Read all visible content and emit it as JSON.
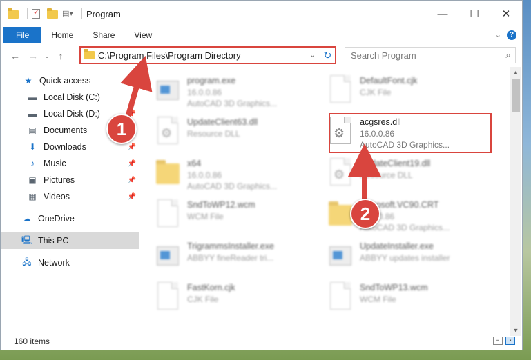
{
  "window": {
    "title": "Program"
  },
  "controls": {
    "minimize": "—",
    "maximize": "☐",
    "close": "✕"
  },
  "ribbon": {
    "tabs": [
      "File",
      "Home",
      "Share",
      "View"
    ]
  },
  "address": {
    "path": "C:\\Program Files\\Program Directory"
  },
  "search": {
    "placeholder": "Search Program"
  },
  "sidebar": {
    "items": [
      {
        "label": "Quick access",
        "icon": "star-icon",
        "pinned": false
      },
      {
        "label": "Local Disk (C:)",
        "icon": "drive-icon",
        "pinned": false
      },
      {
        "label": "Local Disk (D:)",
        "icon": "drive-icon",
        "pinned": true
      },
      {
        "label": "Documents",
        "icon": "documents-icon",
        "pinned": true
      },
      {
        "label": "Downloads",
        "icon": "download-icon",
        "pinned": true
      },
      {
        "label": "Music",
        "icon": "music-icon",
        "pinned": true
      },
      {
        "label": "Pictures",
        "icon": "pictures-icon",
        "pinned": true
      },
      {
        "label": "Videos",
        "icon": "videos-icon",
        "pinned": true
      },
      {
        "label": "OneDrive",
        "icon": "cloud-icon",
        "pinned": false
      },
      {
        "label": "This PC",
        "icon": "computer-icon",
        "pinned": false,
        "selected": true
      },
      {
        "label": "Network",
        "icon": "network-icon",
        "pinned": false
      }
    ]
  },
  "files": [
    {
      "name": "program.exe",
      "meta1": "16.0.0.86",
      "meta2": "AutoCAD 3D Graphics...",
      "kind": "exe"
    },
    {
      "name": "DefaultFont.cjk",
      "meta1": "CJK File",
      "meta2": "",
      "kind": "doc"
    },
    {
      "name": "UpdateClient63.dll",
      "meta1": "Resource DLL",
      "meta2": "",
      "kind": "dll"
    },
    {
      "name": "acgsres.dll",
      "meta1": "16.0.0.86",
      "meta2": "AutoCAD 3D Graphics...",
      "kind": "dll",
      "highlight": true
    },
    {
      "name": "x64",
      "meta1": "16.0.0.86",
      "meta2": "AutoCAD 3D Graphics...",
      "kind": "folder"
    },
    {
      "name": "UpdateClient19.dll",
      "meta1": "Resource DLL",
      "meta2": "",
      "kind": "dll"
    },
    {
      "name": "SndToWP12.wcm",
      "meta1": "WCM File",
      "meta2": "",
      "kind": "doc"
    },
    {
      "name": "Microsoft.VC90.CRT",
      "meta1": "16.0.0.86",
      "meta2": "AutoCAD 3D Graphics...",
      "kind": "folder"
    },
    {
      "name": "TrigrammsInstaller.exe",
      "meta1": "ABBYY fineReader tri...",
      "meta2": "",
      "kind": "exe"
    },
    {
      "name": "UpdateInstaller.exe",
      "meta1": "ABBYY updates installer",
      "meta2": "",
      "kind": "exe"
    },
    {
      "name": "FastKorn.cjk",
      "meta1": "CJK File",
      "meta2": "",
      "kind": "doc"
    },
    {
      "name": "SndToWP13.wcm",
      "meta1": "WCM File",
      "meta2": "",
      "kind": "doc"
    }
  ],
  "status": {
    "count": "160 items"
  },
  "callouts": {
    "one": "1",
    "two": "2"
  },
  "colors": {
    "accent": "#1a73c9",
    "callout": "#d9453e"
  }
}
